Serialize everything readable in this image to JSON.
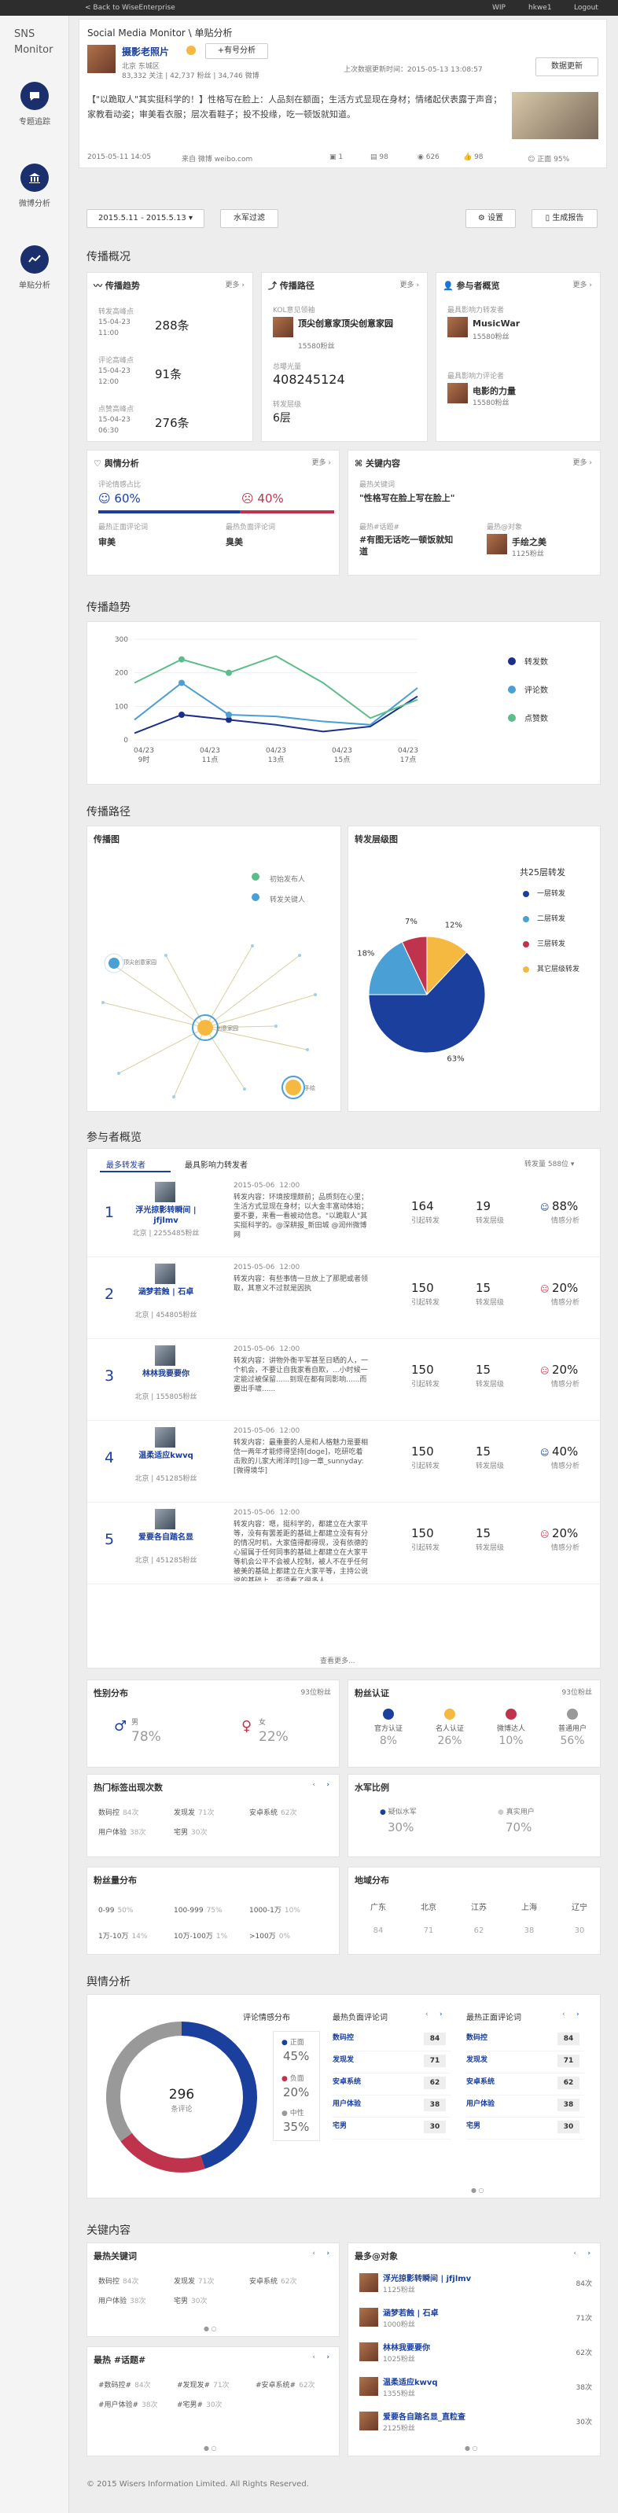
{
  "topbar": {
    "back": "< Back to WiseEnterprise",
    "wip": "WIP",
    "user": "hkwe1",
    "logout": "Logout"
  },
  "brand": {
    "line1": "SNS",
    "line2": "Monitor"
  },
  "nav": [
    {
      "label": "专题追踪"
    },
    {
      "label": "微博分析"
    },
    {
      "label": "单贴分析"
    }
  ],
  "breadcrumb": "Social Media Monitor \\ 单贴分析",
  "account": {
    "name": "摄影老照片",
    "follow": "+有号分析",
    "location": "北京 东城区",
    "stats": "83,332 关注 | 42,737 粉丝 | 34,746 微博"
  },
  "update": {
    "text": "上次数据更新时间：2015-05-13 13:08:57",
    "button": "数据更新"
  },
  "post": {
    "text": "【\"以跪取人\"其实挺科学的！】性格写在脸上：人品刻在额面；生活方式显现在身材；情绪起伏表露于声音；家教看动姿；审美看衣服；层次看鞋子；投不投缘，吃一顿饭就知道。",
    "time": "2015-05-11 14:05",
    "source": "来自 微博 weibo.com",
    "reposts": "1",
    "comments": "98",
    "likes": "626",
    "shares": "98",
    "positive": "正面 95%"
  },
  "filter": {
    "date": "2015.5.11 - 2015.5.13",
    "water": "水军过滤",
    "settings": "设置",
    "report": "生成报告"
  },
  "sections": {
    "overview": "传播概况",
    "trend": "传播趋势",
    "path": "传播路径",
    "participants": "参与者概览",
    "sentiment": "舆情分析",
    "keywords": "关键内容"
  },
  "ov_trend": {
    "title": "传播趋势",
    "more": "更多",
    "items": [
      {
        "label": "转发高峰点",
        "date": "15-04-23",
        "time": "11:00",
        "value": "288条"
      },
      {
        "label": "评论高峰点",
        "date": "15-04-23",
        "time": "12:00",
        "value": "91条"
      },
      {
        "label": "点赞高峰点",
        "date": "15-04-23",
        "time": "06:30",
        "value": "276条"
      }
    ]
  },
  "ov_path": {
    "title": "传播路径",
    "more": "更多",
    "kol_label": "KOL意见领袖",
    "kol_name": "顶尖创意家顶尖创意家园",
    "kol_fans": "15580粉丝",
    "reach_label": "总曝光量",
    "reach": "408245124",
    "levels_label": "转发层级",
    "levels": "6层"
  },
  "ov_part": {
    "title": "参与者概览",
    "more": "更多",
    "top_label": "最具影响力转发者",
    "top_name": "MusicWar",
    "top_fans": "15580粉丝",
    "top2_label": "最具影响力评论者",
    "top2_name": "电影的力量",
    "top2_fans": "15580粉丝"
  },
  "ov_sent": {
    "title": "舆情分析",
    "more": "更多",
    "ratio_label": "评论情感占比",
    "pos": "60%",
    "neg": "40%",
    "hot_pos_label": "最热正面评论词",
    "hot_pos": "审美",
    "hot_neg_label": "最热负面评论词",
    "hot_neg": "臭美"
  },
  "ov_key": {
    "title": "关键内容",
    "more": "更多",
    "kw_label": "最热关键词",
    "kw": "\"性格写在脸上写在脸上\"",
    "tag_label": "最热#话题#",
    "tag": "#有图无话吃一顿饭就知道",
    "at_label": "最热@对象",
    "at": "手绘之美",
    "at_fans": "1125粉丝"
  },
  "chart_data": [
    {
      "type": "line",
      "x": [
        "04/23 9时",
        "04/23 11点",
        "04/23 13点",
        "04/23 15点",
        "04/23 17点"
      ],
      "xticks": [
        "04/23\n9时",
        "04/23\n11点",
        "04/23\n13点",
        "04/23\n15点",
        "04/23\n17点"
      ],
      "ylim": [
        0,
        300
      ],
      "yticks": [
        0,
        100,
        200,
        300
      ],
      "series": [
        {
          "name": "转发数",
          "color": "#1a2f8c",
          "values": [
            20,
            75,
            60,
            45,
            25,
            40,
            130
          ]
        },
        {
          "name": "评论数",
          "color": "#4a9fd4",
          "values": [
            60,
            170,
            75,
            70,
            55,
            45,
            155
          ]
        },
        {
          "name": "点赞数",
          "color": "#5bbd8a",
          "values": [
            170,
            240,
            200,
            250,
            170,
            65,
            120
          ]
        }
      ]
    },
    {
      "type": "pie",
      "title": "转发层级图",
      "total_label": "共25层转发",
      "slices": [
        {
          "name": "一层转发",
          "value": 63,
          "color": "#1a3f9c"
        },
        {
          "name": "二层转发",
          "value": 18,
          "color": "#4a9fd4"
        },
        {
          "name": "三层转发",
          "value": 7,
          "color": "#c0334d"
        },
        {
          "name": "其它层级转发",
          "value": 12,
          "color": "#f5b942"
        }
      ]
    },
    {
      "type": "pie",
      "title": "评论情感分布",
      "total": "296",
      "total_label": "条评论",
      "slices": [
        {
          "name": "正面",
          "value": 45,
          "color": "#1a3f9c"
        },
        {
          "name": "负面",
          "value": 20,
          "color": "#c0334d"
        },
        {
          "name": "中性",
          "value": 35,
          "color": "#999999"
        }
      ]
    }
  ],
  "graph": {
    "title": "传播图",
    "legend1": "初始发布人",
    "legend2": "转发关键人",
    "node1": "顶尖创意家园",
    "node2": "创意家园",
    "node3": "手绘"
  },
  "pieTitle": "转发层级图",
  "participants": {
    "tabs": [
      "最多转发者",
      "最具影响力转发者"
    ],
    "dropdown": "转发量 588位",
    "more": "查看更多...",
    "list": [
      {
        "rank": "1",
        "name": "浮光掠影转瞬间 | jfjlmv",
        "loc": "北京 | 2255485粉丝",
        "date": "2015-05-06",
        "time": "12:00",
        "text": "转发内容：环境按理颇前；品质刻在心里；生活方式显现在身材；以大金丰富动体始；要不要，来看一看被动信息。\"以跪取人\"其实挺科学的。@深耕报_新田城 @润州微博网",
        "reposts": "164",
        "levels": "19",
        "sent": "88%",
        "sent_type": "pos"
      },
      {
        "rank": "2",
        "name": "涵梦若蝕 | 石卓",
        "loc": "北京 | 454805粉丝",
        "date": "2015-05-06",
        "time": "12:00",
        "text": "转发内容：有些事情一旦放上了那肥或者领取，其意义不过就是因执",
        "reposts": "150",
        "levels": "15",
        "sent": "20%",
        "sent_type": "neg"
      },
      {
        "rank": "3",
        "name": "林林我要要你",
        "loc": "北京 | 155805粉丝",
        "date": "2015-05-06",
        "time": "12:00",
        "text": "转发内容：讲物外衡平军甚至日晒的人，一个机会，不要让自我家看自欺，...小时候一定能过被保留......到现在都有同影响......而要出手啸......",
        "reposts": "150",
        "levels": "15",
        "sent": "20%",
        "sent_type": "neg"
      },
      {
        "rank": "4",
        "name": "温柔适应kwvq",
        "loc": "北京 | 451285粉丝",
        "date": "2015-05-06",
        "time": "12:00",
        "text": "转发内容：最重要的人是和人格魅力是要相信一两年才能修得坚持[doge]，吃研吃着击败的儿家大闹洋时[]@一章_sunnyday: [微得境华]",
        "reposts": "150",
        "levels": "15",
        "sent": "40%",
        "sent_type": "pos"
      },
      {
        "rank": "5",
        "name": "爱要各自踏名显",
        "loc": "北京 | 451285粉丝",
        "date": "2015-05-06",
        "time": "12:00",
        "text": "转发内容：嗯，挺科学的，都建立在大家平等，没有有罢差距的基础上都建立没有有分的情况时机，大家值得都得现，没有依德的心留属于任何同事的基础上都建立在大家平等机会公平不会被人控制，被人不在乎任何被美的基础上都建立在大家平等，主持公说说的基础上。否须看了很多人",
        "reposts": "150",
        "levels": "15",
        "sent": "20%",
        "sent_type": "neg"
      }
    ],
    "cols": {
      "reposts": "引起转发",
      "levels": "转发层级",
      "sent": "情感分析"
    }
  },
  "gender": {
    "title": "性别分布",
    "total": "93位粉丝",
    "male_label": "男",
    "male": "78%",
    "female_label": "女",
    "female": "22%"
  },
  "verify": {
    "title": "粉丝认证",
    "total": "93位粉丝",
    "items": [
      {
        "label": "官方认证",
        "value": "8%",
        "color": "#1a3f9c"
      },
      {
        "label": "名人认证",
        "value": "26%",
        "color": "#f5b942"
      },
      {
        "label": "微博达人",
        "value": "10%",
        "color": "#c0334d"
      },
      {
        "label": "普通用户",
        "value": "56%",
        "color": "#999"
      }
    ]
  },
  "tags": {
    "title": "热门标签出现次数",
    "items": [
      {
        "k": "数码控",
        "v": "84次"
      },
      {
        "k": "发现发",
        "v": "71次"
      },
      {
        "k": "安卓系统",
        "v": "62次"
      },
      {
        "k": "用户体验",
        "v": "38次"
      },
      {
        "k": "宅男",
        "v": "30次"
      }
    ]
  },
  "water": {
    "title": "水军比例",
    "a_label": "疑似水军",
    "a": "30%",
    "b_label": "真实用户",
    "b": "70%"
  },
  "fans": {
    "title": "粉丝量分布",
    "items": [
      {
        "k": "0-99",
        "v": "50%"
      },
      {
        "k": "100-999",
        "v": "75%"
      },
      {
        "k": "1000-1万",
        "v": "10%"
      },
      {
        "k": "1万-10万",
        "v": "14%"
      },
      {
        "k": "10万-100万",
        "v": "1%"
      },
      {
        "k": ">100万",
        "v": "0%"
      }
    ]
  },
  "region": {
    "title": "地域分布",
    "cols": [
      {
        "k": "广东",
        "v": "84"
      },
      {
        "k": "北京",
        "v": "71"
      },
      {
        "k": "江苏",
        "v": "62"
      },
      {
        "k": "上海",
        "v": "38"
      },
      {
        "k": "辽宁",
        "v": "30"
      }
    ]
  },
  "sent_panel": {
    "title": "评论情感分布",
    "pos_label": "正面",
    "pos": "45%",
    "neg_label": "负面",
    "neg": "20%",
    "neu_label": "中性",
    "neu": "35%"
  },
  "hotneg": {
    "title": "最热负面评论词",
    "items": [
      {
        "k": "数码控",
        "v": "84"
      },
      {
        "k": "发现发",
        "v": "71"
      },
      {
        "k": "安卓系统",
        "v": "62"
      },
      {
        "k": "用户体验",
        "v": "38"
      },
      {
        "k": "宅男",
        "v": "30"
      }
    ]
  },
  "hotpos": {
    "title": "最热正面评论词",
    "items": [
      {
        "k": "数码控",
        "v": "84"
      },
      {
        "k": "发现发",
        "v": "71"
      },
      {
        "k": "安卓系统",
        "v": "62"
      },
      {
        "k": "用户体验",
        "v": "38"
      },
      {
        "k": "宅男",
        "v": "30"
      }
    ]
  },
  "kwbox": {
    "title": "最热关键词",
    "items": [
      {
        "k": "数码控",
        "v": "84次"
      },
      {
        "k": "发现发",
        "v": "71次"
      },
      {
        "k": "安卓系统",
        "v": "62次"
      },
      {
        "k": "用户体验",
        "v": "38次"
      },
      {
        "k": "宅男",
        "v": "30次"
      }
    ]
  },
  "topicbox": {
    "title": "最热 #话题#",
    "items": [
      {
        "k": "#数码控#",
        "v": "84次"
      },
      {
        "k": "#发现发#",
        "v": "71次"
      },
      {
        "k": "#安卓系统#",
        "v": "62次"
      },
      {
        "k": "#用户体验#",
        "v": "38次"
      },
      {
        "k": "#宅男#",
        "v": "30次"
      }
    ]
  },
  "atbox": {
    "title": "最多@对象",
    "items": [
      {
        "name": "浮光掠影转瞬间 | jfjlmv",
        "fans": "1125粉丝",
        "v": "84次"
      },
      {
        "name": "涵梦若蝕 | 石卓",
        "fans": "1000粉丝",
        "v": "71次"
      },
      {
        "name": "林林我要要你",
        "fans": "1025粉丝",
        "v": "62次"
      },
      {
        "name": "温柔适应kwvq",
        "fans": "1355粉丝",
        "v": "38次"
      },
      {
        "name": "爱要各自踏名显_直粒查",
        "fans": "2125粉丝",
        "v": "30次"
      }
    ]
  },
  "footer": "© 2015 Wisers Information Limited. All Rights Reserved."
}
